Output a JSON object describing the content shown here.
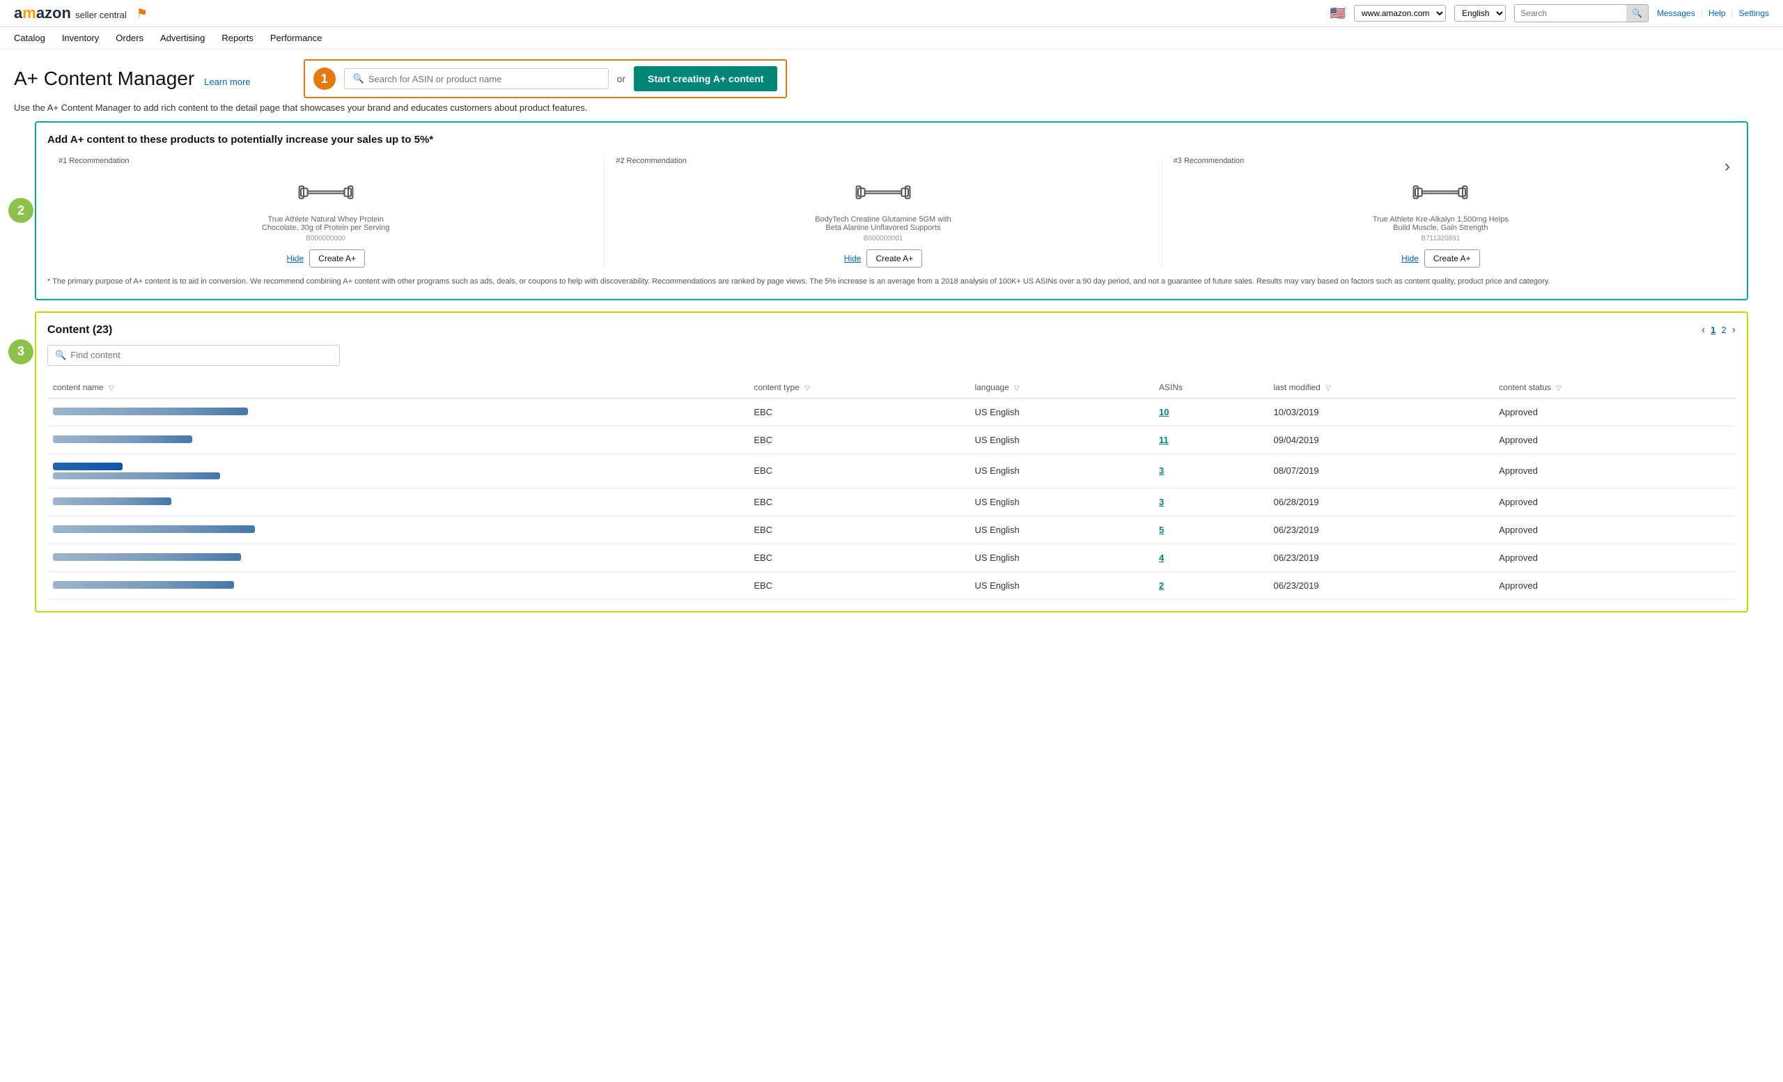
{
  "header": {
    "logo": "amazon",
    "seller_central": "seller central",
    "flag": "🇺🇸",
    "url": "www.amazon.com",
    "language": "English",
    "search_placeholder": "Search",
    "nav_links": [
      "Messages",
      "Help",
      "Settings"
    ]
  },
  "main_nav": {
    "items": [
      "Catalog",
      "Inventory",
      "Orders",
      "Advertising",
      "Reports",
      "Performance"
    ]
  },
  "page": {
    "title": "A+ Content Manager",
    "learn_more": "Learn more",
    "description": "Use the A+ Content Manager to add rich content to the detail page that showcases your brand and educates customers about product features.",
    "asin_search_placeholder": "Search for ASIN or product name",
    "or_text": "or",
    "start_btn": "Start creating A+ content"
  },
  "step_badges": {
    "step1": "1",
    "step2": "2",
    "step3": "3"
  },
  "recommendations": {
    "title": "Add A+ content to these products to potentially increase your sales up to 5%*",
    "items": [
      {
        "rank_label": "#1 Recommendation",
        "name": "True Athlete Natural Whey Protein Chocolate, 30g of Protein per Serving",
        "id": "B000000000",
        "hide_label": "Hide",
        "create_label": "Create A+"
      },
      {
        "rank_label": "#2 Recommendation",
        "name": "BodyTech Creatine Glutamine 5GM with Beta Alanine Unflavored Supports",
        "id": "B000000001",
        "hide_label": "Hide",
        "create_label": "Create A+"
      },
      {
        "rank_label": "#3 Recommendation",
        "name": "True Athlete Kre-Alkalyn 1,500mg Helps Build Muscle, Gain Strength",
        "id": "B711320891",
        "hide_label": "Hide",
        "create_label": "Create A+"
      }
    ],
    "footnote": "* The primary purpose of A+ content is to aid in conversion. We recommend combining A+ content with other programs such as ads, deals, or coupons to help with discoverability. Recommendations are ranked by page views. The 5% increase is an average from a 2018 analysis of 100K+ US ASINs over a 90 day period, and not a guarantee of future sales. Results may vary based on factors such as content quality, product price and category."
  },
  "content_table": {
    "title": "Content",
    "count": "23",
    "find_placeholder": "Find content",
    "pagination": {
      "current": "1",
      "next": "2"
    },
    "columns": [
      "content name",
      "content type",
      "language",
      "ASINs",
      "last modified",
      "content status"
    ],
    "rows": [
      {
        "name": "blurred-long-1",
        "type": "EBC",
        "language": "US English",
        "asins": "10",
        "modified": "10/03/2019",
        "status": "Approved"
      },
      {
        "name": "blurred-whey-protein",
        "type": "EBC",
        "language": "US English",
        "asins": "11",
        "modified": "09/04/2019",
        "status": "Approved"
      },
      {
        "name": "blurred-long-2",
        "type": "EBC",
        "language": "US English",
        "asins": "3",
        "modified": "08/07/2019",
        "status": "Approved"
      },
      {
        "name": "blurred-brand",
        "type": "EBC",
        "language": "US English",
        "asins": "3",
        "modified": "06/28/2019",
        "status": "Approved"
      },
      {
        "name": "blurred-long-3",
        "type": "EBC",
        "language": "US English",
        "asins": "5",
        "modified": "06/23/2019",
        "status": "Approved"
      },
      {
        "name": "blurred-long-4",
        "type": "EBC",
        "language": "US English",
        "asins": "4",
        "modified": "06/23/2019",
        "status": "Approved"
      },
      {
        "name": "blurred-long-5",
        "type": "EBC",
        "language": "US English",
        "asins": "2",
        "modified": "06/23/2019",
        "status": "Approved"
      }
    ],
    "row_widths": [
      260,
      140,
      180,
      120,
      90
    ]
  }
}
